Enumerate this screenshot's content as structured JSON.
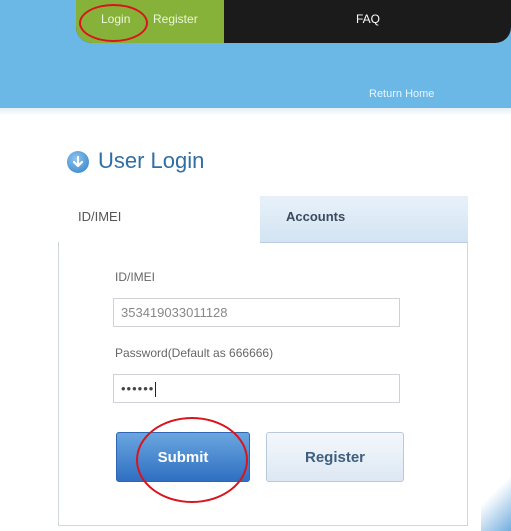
{
  "nav": {
    "login_label": "Login",
    "register_label": "Register",
    "faq_label": "FAQ",
    "return_home_label": "Return Home"
  },
  "heading": {
    "title": "User Login",
    "icon": "arrow-down-circle-icon"
  },
  "tabs": [
    {
      "label": "ID/IMEI"
    },
    {
      "label": "Accounts"
    }
  ],
  "form": {
    "id_label": "ID/IMEI",
    "id_value": "353419033011128",
    "password_label": "Password(Default as 666666)",
    "password_value": "••••••",
    "submit_label": "Submit",
    "register_label": "Register"
  },
  "colors": {
    "band": "#6bb8e6",
    "nav_dark": "#1b1b1b",
    "nav_green": "#86b23a",
    "annotation": "#d8141c",
    "submit": "#2f6fc2"
  }
}
